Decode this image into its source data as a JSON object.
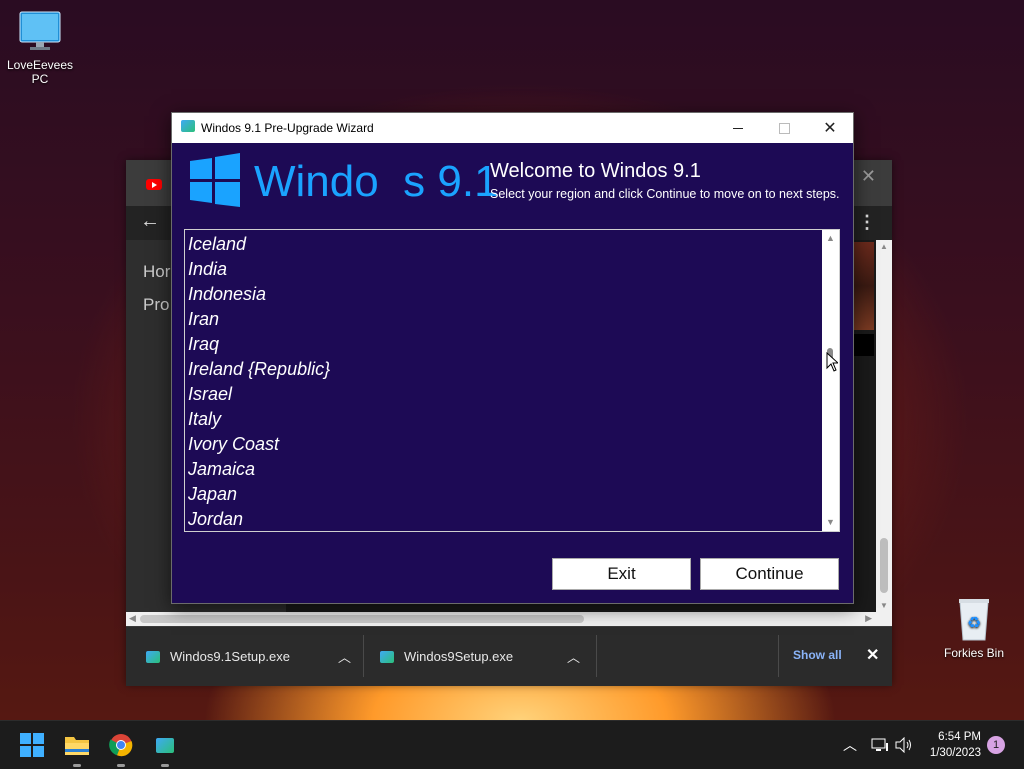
{
  "desktop": {
    "pc_icon_label": "LoveEevees PC",
    "bin_icon_label": "Forkies Bin"
  },
  "browser": {
    "side_items": [
      "Hor",
      "Pro"
    ],
    "downloads": [
      {
        "name": "Windos9.1Setup.exe"
      },
      {
        "name": "Windos9Setup.exe"
      }
    ],
    "show_all": "Show all"
  },
  "wizard": {
    "title": "Windos 9.1 Pre-Upgrade Wizard",
    "logo_text": "Windo  s 9.1",
    "welcome_title": "Welcome to Windos 9.1",
    "welcome_sub": "Select your region and click Continue to move on to next steps.",
    "regions": [
      "Iceland",
      "India",
      "Indonesia",
      "Iran",
      "Iraq",
      "Ireland {Republic}",
      "Israel",
      "Italy",
      "Ivory Coast",
      "Jamaica",
      "Japan",
      "Jordan"
    ],
    "exit_label": "Exit",
    "continue_label": "Continue"
  },
  "taskbar": {
    "time": "6:54 PM",
    "date": "1/30/2023",
    "notifications": "1"
  },
  "colors": {
    "wizard_bg": "#1d0a55",
    "accent": "#1aa3ff",
    "link": "#8ab4f8"
  }
}
